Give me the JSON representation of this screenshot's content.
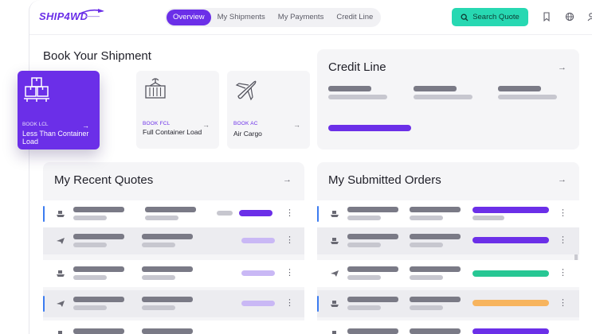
{
  "header": {
    "logo": "SHIP4WD",
    "nav": [
      {
        "label": "Overview",
        "active": true
      },
      {
        "label": "My Shipments",
        "active": false
      },
      {
        "label": "My Payments",
        "active": false
      },
      {
        "label": "Credit Line",
        "active": false
      }
    ],
    "search_label": "Search Quote"
  },
  "book": {
    "title": "Book Your Shipment",
    "cards": [
      {
        "kind": "BOOK LCL",
        "name": "Less Than Container Load",
        "icon": "boxes-icon"
      },
      {
        "kind": "BOOK FCL",
        "name": "Full Container Load",
        "icon": "container-icon"
      },
      {
        "kind": "BOOK AC",
        "name": "Air Cargo",
        "icon": "airplane-icon"
      }
    ]
  },
  "credit": {
    "title": "Credit Line"
  },
  "quotes": {
    "title": "My Recent Quotes",
    "rows": [
      {
        "icon": "ship-icon",
        "status_color": "#6b2fe8",
        "marked": true
      },
      {
        "icon": "airplane-icon",
        "status_color": "#c9b8f5",
        "marked": false
      },
      {
        "icon": "ship-icon",
        "status_color": "#c9b8f5",
        "marked": false
      },
      {
        "icon": "airplane-icon",
        "status_color": "#c9b8f5",
        "marked": true
      }
    ]
  },
  "orders": {
    "title": "My Submitted Orders",
    "rows": [
      {
        "icon": "ship-icon",
        "status_color": "#6b2fe8",
        "marked": true
      },
      {
        "icon": "ship-icon",
        "status_color": "#6b2fe8",
        "marked": false
      },
      {
        "icon": "airplane-icon",
        "status_color": "#27c794",
        "marked": false
      },
      {
        "icon": "ship-icon",
        "status_color": "#f7b45e",
        "marked": true
      }
    ]
  }
}
